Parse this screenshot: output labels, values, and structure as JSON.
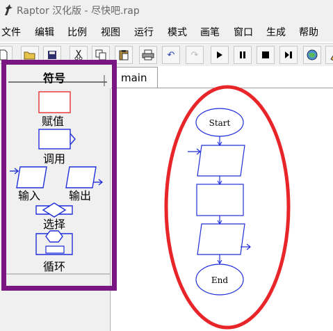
{
  "window": {
    "title": "Raptor 汉化版 - 尽快吧.rap"
  },
  "menu": [
    "文件",
    "编辑",
    "比例",
    "视图",
    "运行",
    "模式",
    "画笔",
    "窗口",
    "生成",
    "帮助"
  ],
  "toolbar": {
    "buttons": [
      "new-icon",
      "open-icon",
      "save-icon",
      "cut-icon",
      "copy-icon",
      "paste-icon",
      "print-icon",
      "undo-icon",
      "redo-icon",
      "run-icon",
      "pause-icon",
      "stop-icon",
      "step-icon",
      "globe-icon",
      "pen-icon"
    ]
  },
  "symbols": {
    "header": "符号",
    "items": [
      "赋值",
      "调用",
      "输入",
      "输出",
      "选择",
      "循环"
    ]
  },
  "tab": {
    "label": "main"
  },
  "flowchart": {
    "start_label": "Start",
    "end_label": "End"
  },
  "colors": {
    "annotation_purple": "#7a1682",
    "annotation_red": "#e8262a",
    "flow_blue": "#1f2fd8",
    "assign_red": "#e23030"
  }
}
